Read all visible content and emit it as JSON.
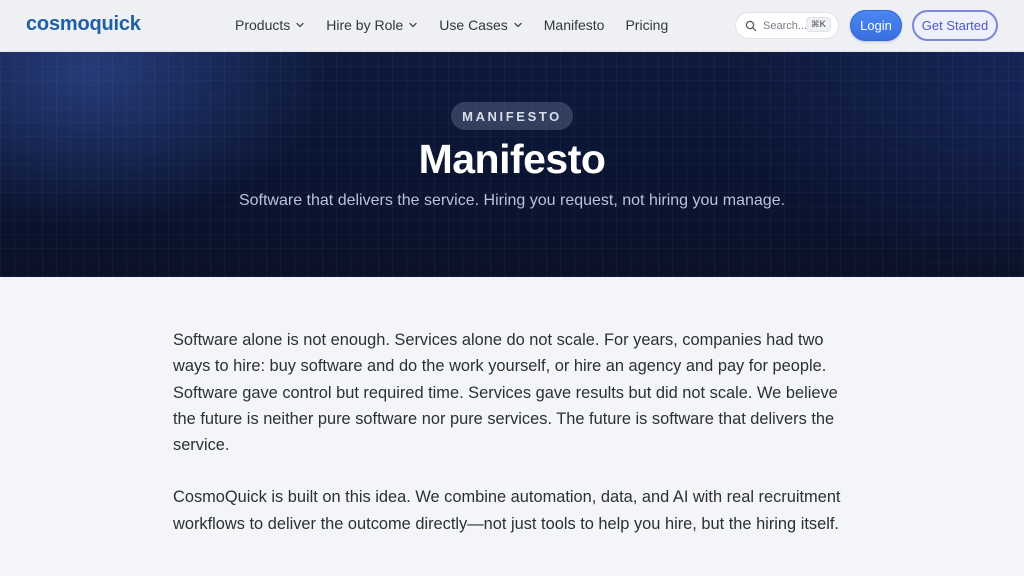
{
  "header": {
    "logo": "cosmoquick",
    "nav": [
      {
        "label": "Products",
        "has_dropdown": true
      },
      {
        "label": "Hire by Role",
        "has_dropdown": true
      },
      {
        "label": "Use Cases",
        "has_dropdown": true
      },
      {
        "label": "Manifesto",
        "has_dropdown": false
      },
      {
        "label": "Pricing",
        "has_dropdown": false
      }
    ],
    "search": {
      "placeholder": "Search...",
      "shortcut": "⌘K",
      "icon": "search-icon"
    },
    "login_label": "Login",
    "get_started_label": "Get Started"
  },
  "hero": {
    "badge": "MANIFESTO",
    "title": "Manifesto",
    "subtitle": "Software that delivers the service. Hiring you request, not hiring you manage."
  },
  "body": {
    "paragraphs": [
      "Software alone is not enough. Services alone do not scale. For years, companies had two ways to hire: buy software and do the work yourself, or hire an agency and pay for people. Software gave control but required time. Services gave results but did not scale. We believe the future is neither pure software nor pure services. The future is software that delivers the service.",
      "CosmoQuick is built on this idea. We combine automation, data, and AI with real recruitment workflows to deliver the outcome directly—not just tools to help you hire, but the hiring itself."
    ]
  },
  "colors": {
    "brand": "#1f5fa8",
    "login_bg": "#3a6fe0",
    "get_started_border": "#7d87d8",
    "hero_bg": "#0c1634",
    "page_bg": "#f4f5f8"
  }
}
